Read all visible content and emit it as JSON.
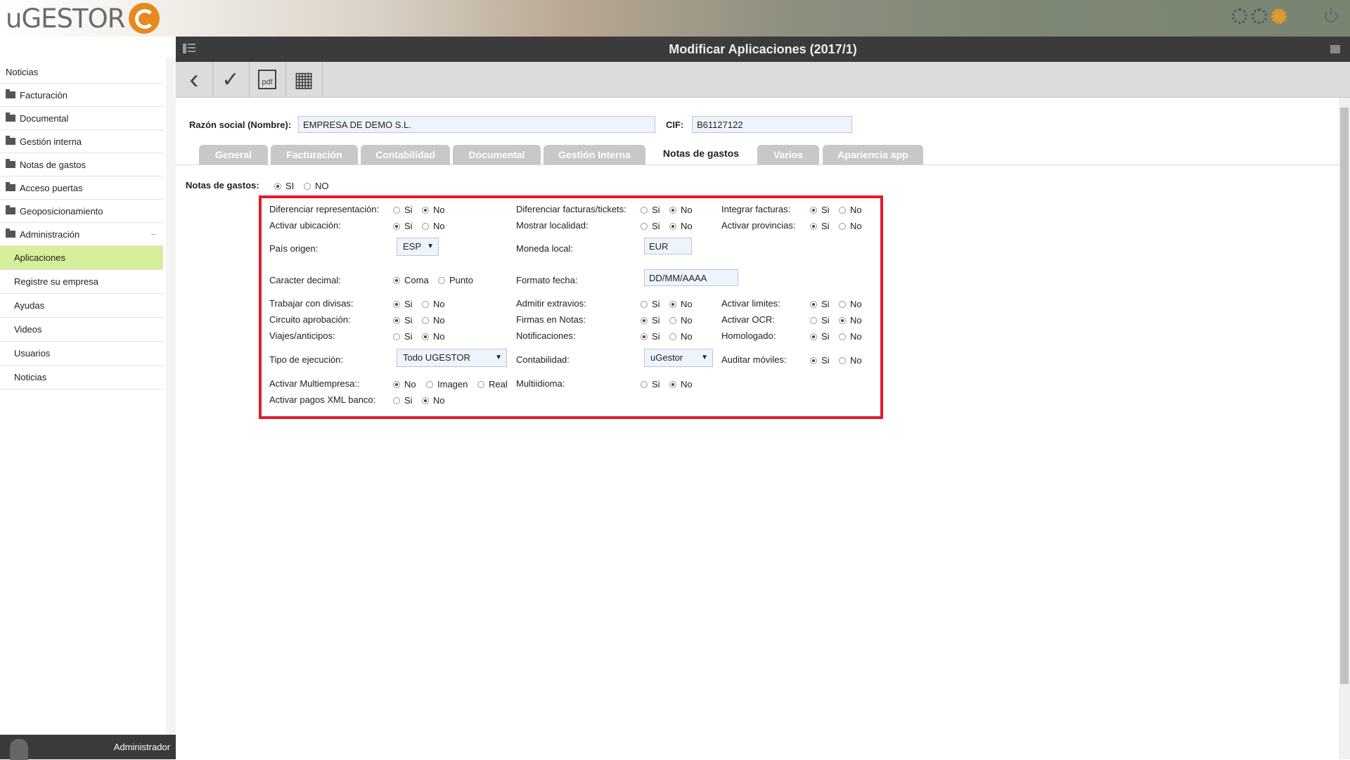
{
  "brand": {
    "logo_u": "u",
    "logo_rest": "GESTOR"
  },
  "sidebar": {
    "items": [
      {
        "label": "Noticias",
        "folder": false,
        "sub": false,
        "active": false
      },
      {
        "label": "Facturación",
        "folder": true,
        "sub": false,
        "active": false
      },
      {
        "label": "Documental",
        "folder": true,
        "sub": false,
        "active": false
      },
      {
        "label": "Gestión interna",
        "folder": true,
        "sub": false,
        "active": false
      },
      {
        "label": "Notas de gastos",
        "folder": true,
        "sub": false,
        "active": false
      },
      {
        "label": "Acceso puertas",
        "folder": true,
        "sub": false,
        "active": false
      },
      {
        "label": "Geoposicionamiento",
        "folder": true,
        "sub": false,
        "active": false
      },
      {
        "label": "Administración",
        "folder": true,
        "sub": false,
        "active": false
      },
      {
        "label": "Aplicaciones",
        "folder": false,
        "sub": true,
        "active": true
      },
      {
        "label": "Registre su empresa",
        "folder": false,
        "sub": true,
        "active": false
      },
      {
        "label": "Ayudas",
        "folder": false,
        "sub": true,
        "active": false
      },
      {
        "label": "Videos",
        "folder": false,
        "sub": true,
        "active": false
      },
      {
        "label": "Usuarios",
        "folder": false,
        "sub": true,
        "active": false
      },
      {
        "label": "Noticias",
        "folder": false,
        "sub": true,
        "active": false
      }
    ],
    "collapse_symbol": "−",
    "user": "Administrador"
  },
  "header": {
    "title": "Modificar Aplicaciones (2017/1)"
  },
  "toolbar": {
    "back": "‹",
    "save": "✓",
    "pdf": "pdf",
    "calendar": "▦"
  },
  "form": {
    "razon_label": "Razón social (Nombre):",
    "razon_value": "EMPRESA DE DEMO S.L.",
    "cif_label": "CIF:",
    "cif_value": "B61127122"
  },
  "tabs": [
    "General",
    "Facturación",
    "Contabilidad",
    "Documental",
    "Gestión Interna",
    "Notas de gastos",
    "Varios",
    "Apariencia app"
  ],
  "notas": {
    "label": "Notas de gastos:",
    "si": "SI",
    "no": "NO",
    "options": {
      "yes": "Si",
      "no": "No",
      "coma": "Coma",
      "punto": "Punto",
      "imagen": "Imagen",
      "real": "Real"
    },
    "fields": {
      "dif_rep": "Diferenciar representación:",
      "act_ubic": "Activar ubicación:",
      "pais": "País origen:",
      "pais_value": "ESP",
      "caracter": "Caracter decimal:",
      "divisas": "Trabajar con divisas:",
      "circuito": "Circuito aprobación:",
      "viajes": "Viajes/anticipos:",
      "tipo_ejec": "Tipo de ejecución:",
      "tipo_ejec_value": "Todo UGESTOR",
      "multiempresa": "Activar Multiempresa::",
      "pagos_xml": "Activar pagos XML banco:",
      "dif_fact": "Diferenciar facturas/tickets:",
      "mostrar_loc": "Mostrar localidad:",
      "moneda": "Moneda local:",
      "moneda_value": "EUR",
      "formato": "Formato fecha:",
      "formato_value": "DD/MM/AAAA",
      "extravios": "Admitir extravios:",
      "firmas": "Firmas en Notas:",
      "notif": "Notificaciones:",
      "contab": "Contabilidad:",
      "contab_value": "uGestor",
      "multiidioma": "Multiidioma:",
      "integrar": "Integrar facturas:",
      "provincias": "Activar provincias:",
      "limites": "Activar limites:",
      "ocr": "Activar OCR:",
      "homologado": "Homologado:",
      "auditar": "Auditar móviles:"
    }
  }
}
